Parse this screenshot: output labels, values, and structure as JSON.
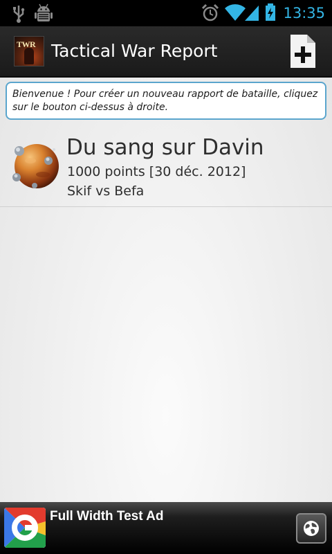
{
  "status_bar": {
    "time": "13:35",
    "icons": [
      "usb-icon",
      "android-debug-icon",
      "alarm-icon",
      "wifi-icon",
      "signal-icon",
      "battery-charging-icon"
    ],
    "accent_color": "#33b5e5"
  },
  "action_bar": {
    "title": "Tactical War Report",
    "logo_text": "TWR",
    "add_icon": "add-document-icon"
  },
  "welcome": {
    "message": "Bienvenue ! Pour créer un nouveau rapport de bataille, cliquez sur le bouton ci-dessus à droite."
  },
  "reports": [
    {
      "title": "Du sang sur Davin",
      "subtitle": "1000 points [30 déc. 2012]",
      "players": "Skif vs Befa",
      "icon": "planet-icon"
    }
  ],
  "ad": {
    "text": "Full Width Test Ad",
    "logo_icon": "google-logo-icon",
    "action_icon": "globe-icon"
  },
  "colors": {
    "banner_border": "#5aa5cd",
    "action_bar": "#222222"
  }
}
